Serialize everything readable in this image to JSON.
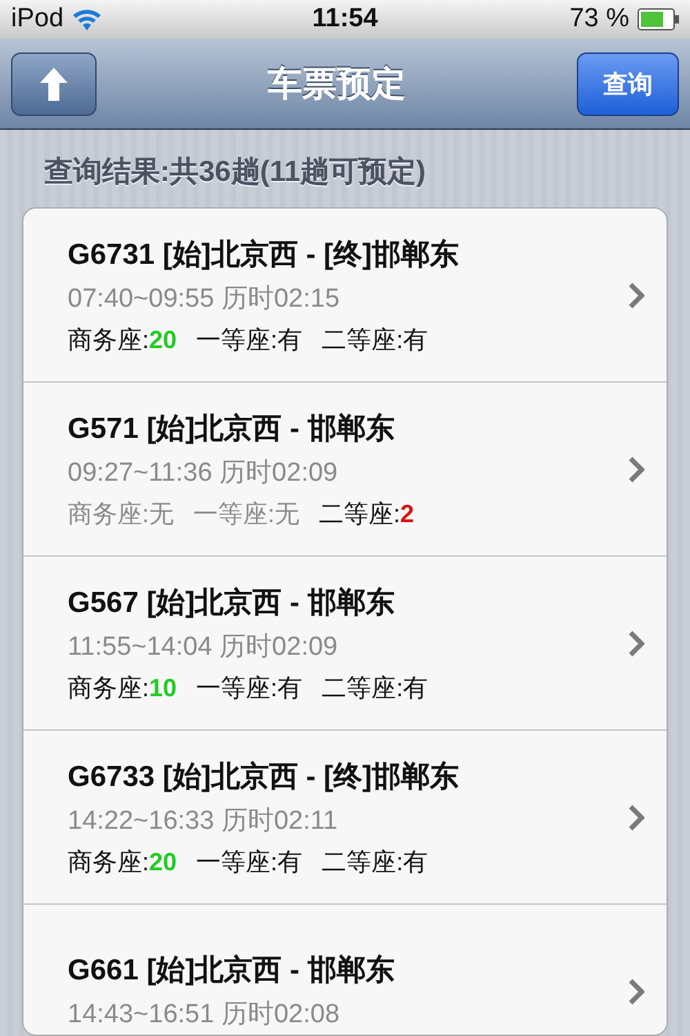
{
  "status_bar": {
    "carrier": "iPod",
    "time": "11:54",
    "battery": "73 %"
  },
  "nav_bar": {
    "title": "车票预定",
    "action": "查询"
  },
  "summary": "查询结果:共36趟(11趟可预定)",
  "trains": [
    {
      "name": "G6731 [始]北京西 - [终]邯郸东",
      "times": "07:40~09:55 历时02:15",
      "seats": [
        {
          "label": "商务座:",
          "value": "20",
          "available": true,
          "color": "#22cc22"
        },
        {
          "label": "一等座:",
          "value": "有",
          "available": true
        },
        {
          "label": "二等座:",
          "value": "有",
          "available": true
        }
      ]
    },
    {
      "name": "G571 [始]北京西 - 邯郸东",
      "times": "09:27~11:36 历时02:09",
      "seats": [
        {
          "label": "商务座:",
          "value": "无",
          "available": false
        },
        {
          "label": "一等座:",
          "value": "无",
          "available": false
        },
        {
          "label": "二等座:",
          "value": "2",
          "available": true,
          "color": "#dd1111"
        }
      ]
    },
    {
      "name": "G567 [始]北京西 - 邯郸东",
      "times": "11:55~14:04 历时02:09",
      "seats": [
        {
          "label": "商务座:",
          "value": "10",
          "available": true,
          "color": "#22cc22"
        },
        {
          "label": "一等座:",
          "value": "有",
          "available": true
        },
        {
          "label": "二等座:",
          "value": "有",
          "available": true
        }
      ]
    },
    {
      "name": "G6733 [始]北京西 - [终]邯郸东",
      "times": "14:22~16:33 历时02:11",
      "seats": [
        {
          "label": "商务座:",
          "value": "20",
          "available": true,
          "color": "#22cc22"
        },
        {
          "label": "一等座:",
          "value": "有",
          "available": true
        },
        {
          "label": "二等座:",
          "value": "有",
          "available": true
        }
      ]
    },
    {
      "name": "G661 [始]北京西 - 邯郸东",
      "times": "14:43~16:51 历时02:08"
    }
  ]
}
